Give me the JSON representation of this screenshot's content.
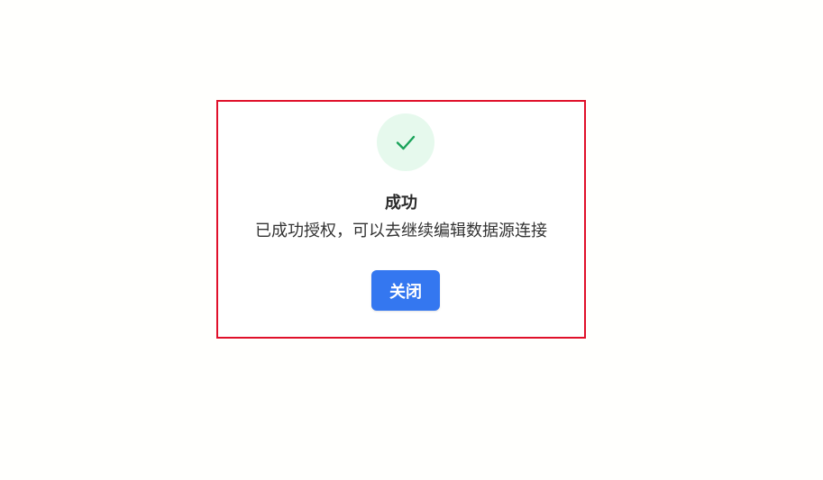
{
  "dialog": {
    "icon": "check-icon",
    "title": "成功",
    "message": "已成功授权，可以去继续编辑数据源连接",
    "close_label": "关闭"
  },
  "colors": {
    "highlight_border": "#e0102a",
    "success_circle_bg": "#e6f9ed",
    "check_color": "#1aa35a",
    "button_bg": "#3477f0",
    "button_text": "#ffffff",
    "title_text": "#2b2b2b",
    "message_text": "#333333"
  }
}
